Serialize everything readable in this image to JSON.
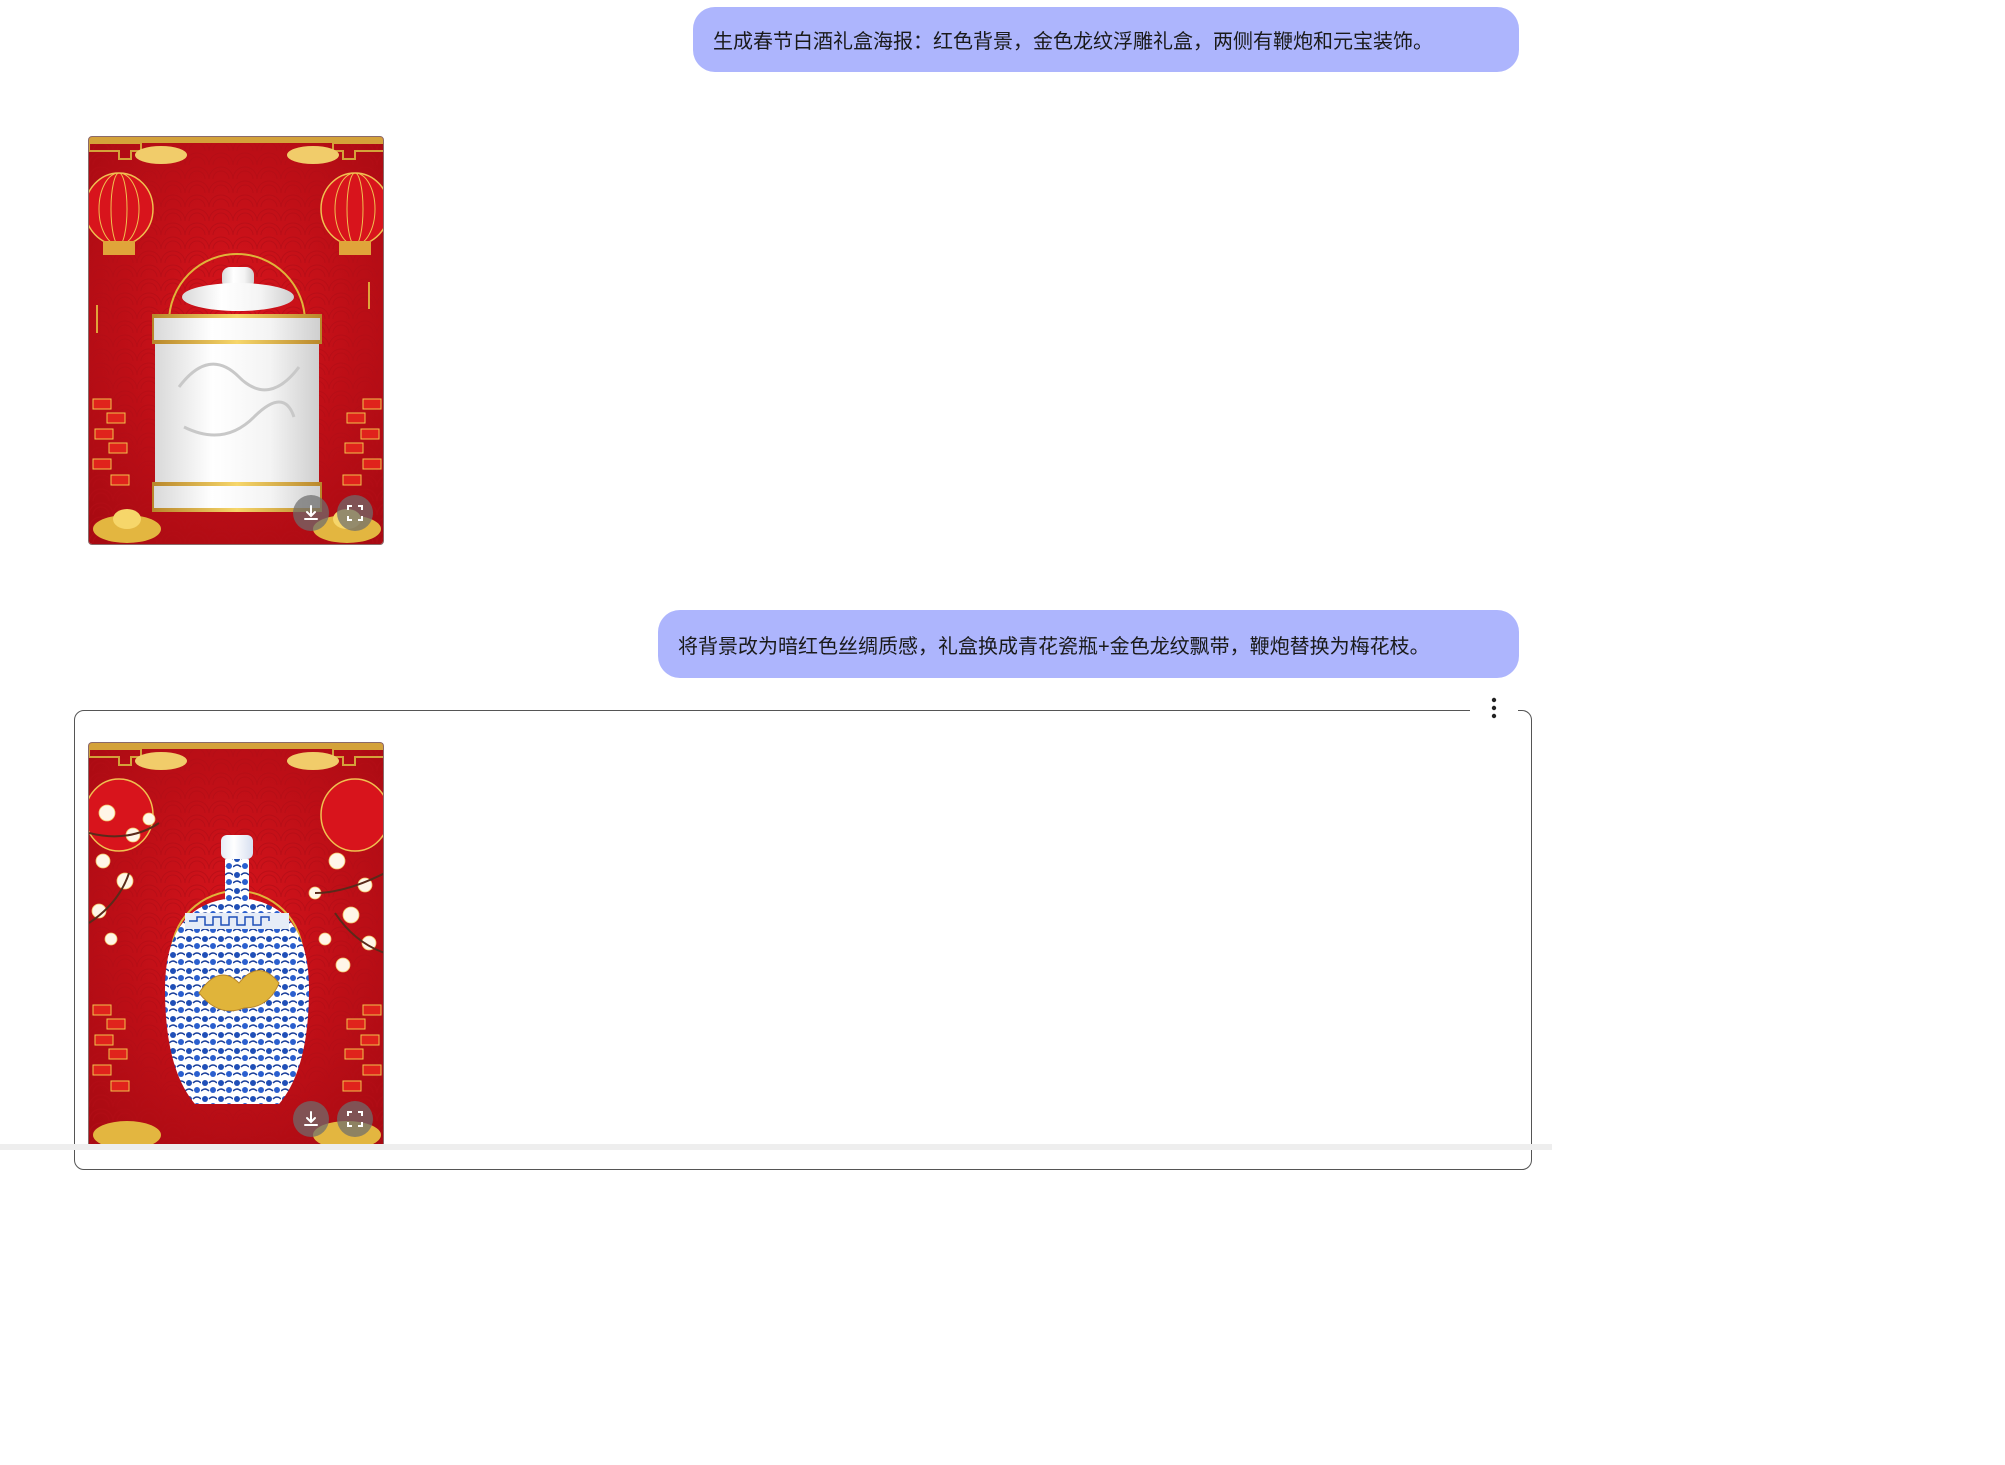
{
  "conversation": {
    "messages": [
      {
        "role": "user",
        "text": "生成春节白酒礼盒海报：红色背景，金色龙纹浮雕礼盒，两侧有鞭炮和元宝装饰。"
      },
      {
        "role": "assistant",
        "image": "poster-white-dragon-jar"
      },
      {
        "role": "user",
        "text": "将背景改为暗红色丝绸质感，礼盒换成青花瓷瓶+金色龙纹飘带，鞭炮替换为梅花枝。"
      },
      {
        "role": "assistant",
        "image": "poster-blue-white-vase"
      }
    ]
  },
  "actions": {
    "download_icon": "download-icon",
    "fullscreen_icon": "expand-icon",
    "more_icon": "more-vertical-icon"
  },
  "colors": {
    "user_bubble": "#adb5fd",
    "poster_red": "#c8101a",
    "gold": "#e0b43a"
  }
}
